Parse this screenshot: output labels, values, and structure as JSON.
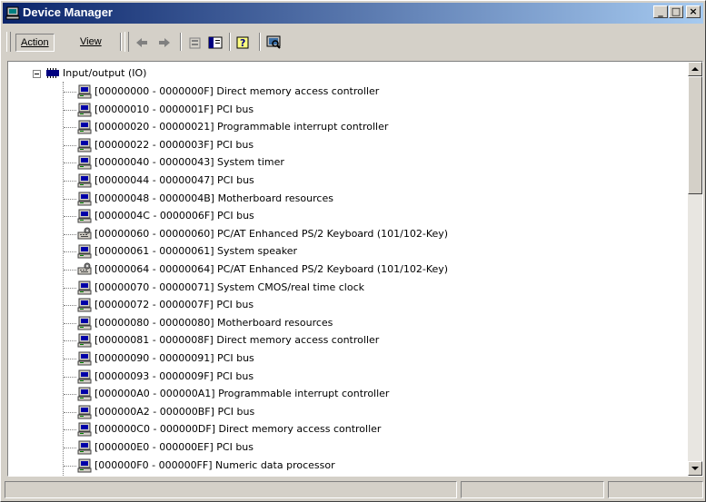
{
  "window": {
    "title": "Device Manager",
    "app_icon": "computer-icon",
    "title_gradient": [
      "#0a246a",
      "#a6caf0"
    ],
    "controls": {
      "minimize": "_",
      "maximize": "□",
      "close": "×"
    }
  },
  "toolbar": {
    "menu": {
      "action": "Action",
      "view": "View"
    },
    "buttons": [
      "back-icon",
      "forward-icon",
      "properties-icon",
      "show-hide-tree-icon",
      "help-icon",
      "scan-hardware-icon"
    ]
  },
  "tree": {
    "root": {
      "label": "Input/output (IO)",
      "icon": "io-ports-icon",
      "expanded": true
    },
    "items": [
      {
        "range": "[00000000 - 0000000F]",
        "device": "Direct memory access controller",
        "icon": "system-device-icon"
      },
      {
        "range": "[00000010 - 0000001F]",
        "device": "PCI bus",
        "icon": "system-device-icon"
      },
      {
        "range": "[00000020 - 00000021]",
        "device": "Programmable interrupt controller",
        "icon": "system-device-icon"
      },
      {
        "range": "[00000022 - 0000003F]",
        "device": "PCI bus",
        "icon": "system-device-icon"
      },
      {
        "range": "[00000040 - 00000043]",
        "device": "System timer",
        "icon": "system-device-icon"
      },
      {
        "range": "[00000044 - 00000047]",
        "device": "PCI bus",
        "icon": "system-device-icon"
      },
      {
        "range": "[00000048 - 0000004B]",
        "device": "Motherboard resources",
        "icon": "system-device-icon"
      },
      {
        "range": "[0000004C - 0000006F]",
        "device": "PCI bus",
        "icon": "system-device-icon"
      },
      {
        "range": "[00000060 - 00000060]",
        "device": "PC/AT Enhanced PS/2 Keyboard (101/102-Key)",
        "icon": "keyboard-icon"
      },
      {
        "range": "[00000061 - 00000061]",
        "device": "System speaker",
        "icon": "system-device-icon"
      },
      {
        "range": "[00000064 - 00000064]",
        "device": "PC/AT Enhanced PS/2 Keyboard (101/102-Key)",
        "icon": "keyboard-icon"
      },
      {
        "range": "[00000070 - 00000071]",
        "device": "System CMOS/real time clock",
        "icon": "system-device-icon"
      },
      {
        "range": "[00000072 - 0000007F]",
        "device": "PCI bus",
        "icon": "system-device-icon"
      },
      {
        "range": "[00000080 - 00000080]",
        "device": "Motherboard resources",
        "icon": "system-device-icon"
      },
      {
        "range": "[00000081 - 0000008F]",
        "device": "Direct memory access controller",
        "icon": "system-device-icon"
      },
      {
        "range": "[00000090 - 00000091]",
        "device": "PCI bus",
        "icon": "system-device-icon"
      },
      {
        "range": "[00000093 - 0000009F]",
        "device": "PCI bus",
        "icon": "system-device-icon"
      },
      {
        "range": "[000000A0 - 000000A1]",
        "device": "Programmable interrupt controller",
        "icon": "system-device-icon"
      },
      {
        "range": "[000000A2 - 000000BF]",
        "device": "PCI bus",
        "icon": "system-device-icon"
      },
      {
        "range": "[000000C0 - 000000DF]",
        "device": "Direct memory access controller",
        "icon": "system-device-icon"
      },
      {
        "range": "[000000E0 - 000000EF]",
        "device": "PCI bus",
        "icon": "system-device-icon"
      },
      {
        "range": "[000000F0 - 000000FF]",
        "device": "Numeric data processor",
        "icon": "system-device-icon"
      }
    ]
  },
  "statusbar": {
    "panels": [
      "",
      "",
      ""
    ]
  }
}
